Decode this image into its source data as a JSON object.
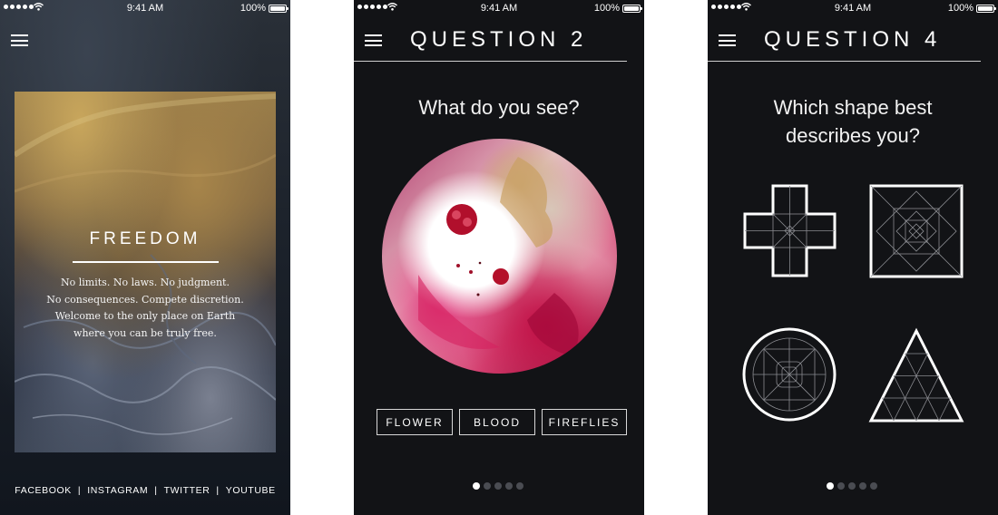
{
  "statusbar": {
    "time": "9:41 AM",
    "battery": "100%"
  },
  "screen1": {
    "title": "FREEDOM",
    "body_lines": [
      "No limits. No laws. No judgment.",
      "No consequences. Compete discretion.",
      "Welcome to the only place on Earth",
      "where you can be truly free."
    ],
    "social": [
      "FACEBOOK",
      "INSTAGRAM",
      "TWITTER",
      "YOUTUBE"
    ],
    "separator": "|"
  },
  "screen2": {
    "title": "QUESTION 2",
    "question": "What do you see?",
    "answers": [
      "FLOWER",
      "BLOOD",
      "FIREFLIES"
    ],
    "pager": {
      "total": 5,
      "active": 1
    }
  },
  "screen3": {
    "title": "QUESTION 4",
    "question_lines": [
      "Which shape best",
      "describes you?"
    ],
    "shapes": [
      "cross-icon",
      "square-icon",
      "circle-icon",
      "triangle-icon"
    ],
    "pager": {
      "total": 5,
      "active": 1
    }
  },
  "colors": {
    "background": "#121316",
    "accent": "#ffffff",
    "pager_inactive": "#4a4c52"
  }
}
